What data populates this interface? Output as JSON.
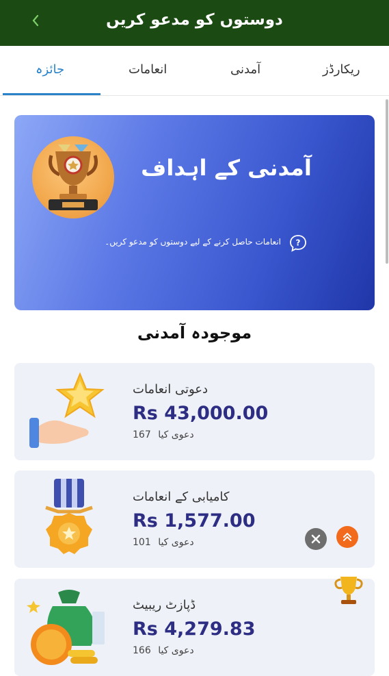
{
  "header": {
    "title": "دوستوں کو مدعو کریں",
    "back_icon": "chevron-left-icon"
  },
  "tabs": [
    {
      "label": "ریکارڈز",
      "active": false
    },
    {
      "label": "آمدنی",
      "active": false
    },
    {
      "label": "انعامات",
      "active": false
    },
    {
      "label": "جائزہ",
      "active": true
    }
  ],
  "hero": {
    "title": "آمدنی کے اہداف",
    "subtitle": "انعامات حاصل کرنے کے لیے دوستوں کو مدعو کریں۔",
    "icon": "trophy-icon",
    "help_icon": "question-bubble-icon"
  },
  "section_title": "موجودہ آمدنی",
  "cards": [
    {
      "label": "دعوتی انعامات",
      "amount": "Rs  43,000.00",
      "count": "167",
      "count_label": "دعوی کیا",
      "icon": "star-hand-icon"
    },
    {
      "label": "کامیابی کے انعامات",
      "amount": "Rs  1,577.00",
      "count": "101",
      "count_label": "دعوی کیا",
      "icon": "medal-icon"
    },
    {
      "label": "ڈپازٹ ریبیٹ",
      "amount": "Rs  4,279.83",
      "count": "166",
      "count_label": "دعوی کیا",
      "icon": "money-bag-icon"
    }
  ],
  "floating": {
    "close_icon": "close-icon",
    "up_icon": "double-chevron-up-icon",
    "trophy_icon": "trophy-icon"
  },
  "colors": {
    "header_bg": "#1c4a13",
    "tab_active": "#2a83c8",
    "amount": "#2d2e83",
    "fab_up": "#f26a1b"
  }
}
